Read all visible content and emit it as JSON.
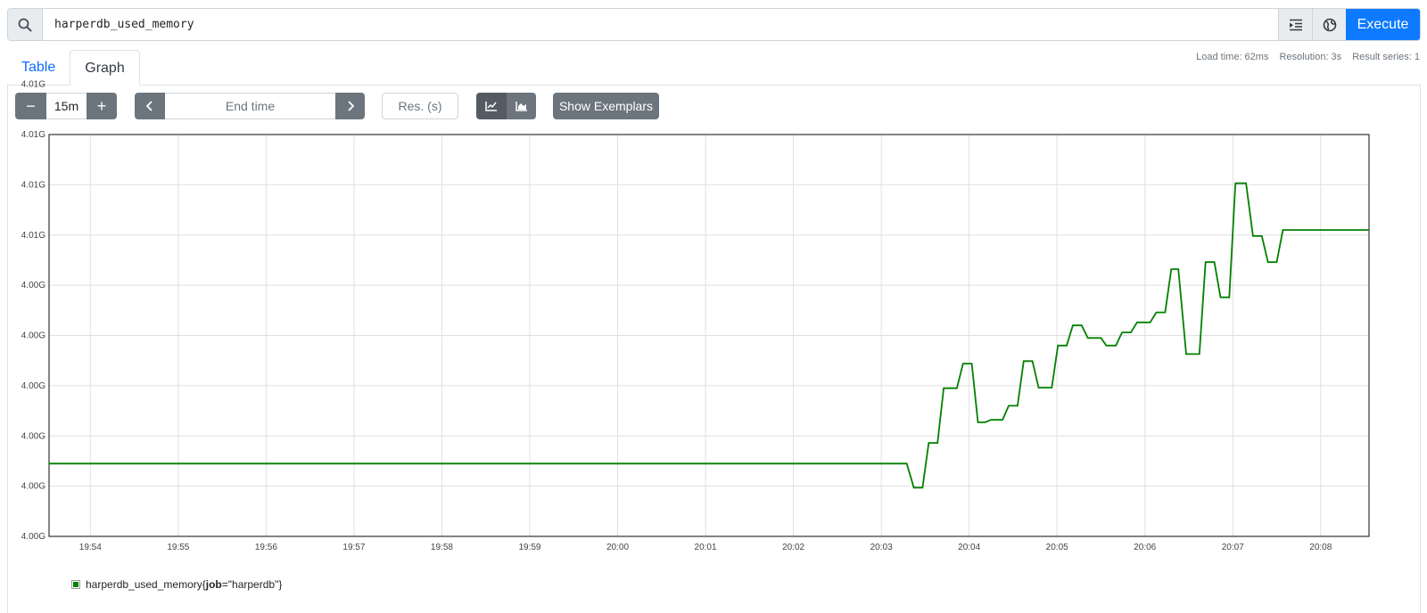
{
  "query": {
    "value": "harperdb_used_memory",
    "execute_label": "Execute"
  },
  "icons": {
    "search": "search-icon",
    "format": "format-indent-icon",
    "metrics_explorer": "globe-icon"
  },
  "tabs": [
    {
      "label": "Table",
      "active": false
    },
    {
      "label": "Graph",
      "active": true
    }
  ],
  "stats": {
    "load_time": "Load time: 62ms",
    "resolution": "Resolution: 3s",
    "result_series": "Result series: 1"
  },
  "controls": {
    "range_minus": "−",
    "range_value": "15m",
    "range_plus": "+",
    "end_time_placeholder": "End time",
    "resolution_placeholder": "Res. (s)",
    "show_exemplars": "Show Exemplars"
  },
  "colors": {
    "accent": "#0d7aff",
    "series": "#008000"
  },
  "legend": {
    "metric": "harperdb_used_memory",
    "label_key": "job",
    "label_value": "\"harperdb\""
  },
  "chart_data": {
    "type": "line",
    "x_ticks": [
      "19:54",
      "19:55",
      "19:56",
      "19:57",
      "19:58",
      "19:59",
      "20:00",
      "20:01",
      "20:02",
      "20:03",
      "20:04",
      "20:05",
      "20:06",
      "20:07",
      "20:08"
    ],
    "y_ticks": [
      "4.00G",
      "4.00G",
      "4.00G",
      "4.00G",
      "4.00G",
      "4.00G",
      "4.01G",
      "4.01G",
      "4.01G",
      "4.01G"
    ],
    "x_range_minutes": [
      -0.47,
      14.55
    ],
    "y_range_steps": [
      0,
      8
    ],
    "grid": true,
    "legend_position": "bottom-left",
    "series": [
      {
        "name": "harperdb_used_memory{job=\"harperdb\"}",
        "points": [
          [
            -0.47,
            1.45
          ],
          [
            9.29,
            1.45
          ],
          [
            9.37,
            0.97
          ],
          [
            9.47,
            0.97
          ],
          [
            9.54,
            1.86
          ],
          [
            9.64,
            1.86
          ],
          [
            9.71,
            2.95
          ],
          [
            9.86,
            2.95
          ],
          [
            9.93,
            3.44
          ],
          [
            10.03,
            3.44
          ],
          [
            10.1,
            2.27
          ],
          [
            10.18,
            2.27
          ],
          [
            10.25,
            2.32
          ],
          [
            10.38,
            2.32
          ],
          [
            10.45,
            2.6
          ],
          [
            10.55,
            2.6
          ],
          [
            10.62,
            3.49
          ],
          [
            10.72,
            3.49
          ],
          [
            10.79,
            2.96
          ],
          [
            10.94,
            2.96
          ],
          [
            11.01,
            3.8
          ],
          [
            11.11,
            3.8
          ],
          [
            11.18,
            4.2
          ],
          [
            11.28,
            4.2
          ],
          [
            11.35,
            3.95
          ],
          [
            11.5,
            3.95
          ],
          [
            11.56,
            3.8
          ],
          [
            11.67,
            3.8
          ],
          [
            11.74,
            4.06
          ],
          [
            11.84,
            4.06
          ],
          [
            11.91,
            4.26
          ],
          [
            12.06,
            4.26
          ],
          [
            12.13,
            4.46
          ],
          [
            12.23,
            4.46
          ],
          [
            12.3,
            5.32
          ],
          [
            12.38,
            5.32
          ],
          [
            12.47,
            3.63
          ],
          [
            12.62,
            3.63
          ],
          [
            12.69,
            5.46
          ],
          [
            12.79,
            5.46
          ],
          [
            12.86,
            4.76
          ],
          [
            12.96,
            4.76
          ],
          [
            13.03,
            7.03
          ],
          [
            13.15,
            7.03
          ],
          [
            13.23,
            5.98
          ],
          [
            13.33,
            5.98
          ],
          [
            13.4,
            5.46
          ],
          [
            13.5,
            5.46
          ],
          [
            13.57,
            6.1
          ],
          [
            14.55,
            6.1
          ]
        ]
      }
    ]
  }
}
